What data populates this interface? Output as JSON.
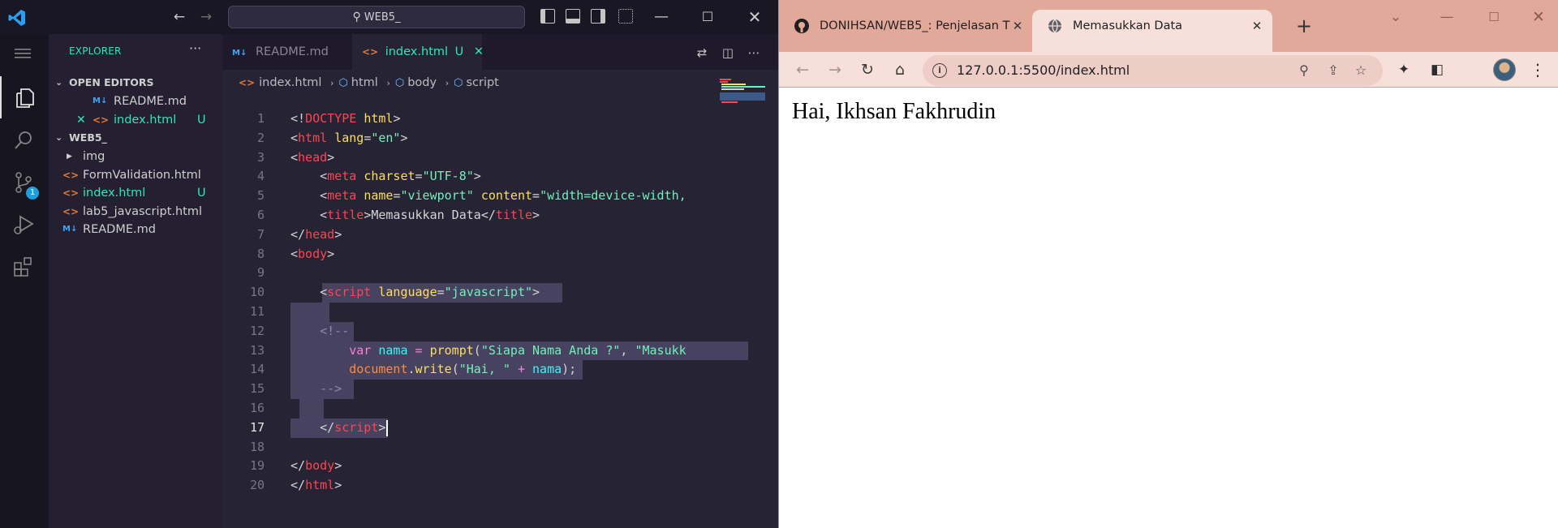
{
  "vscode": {
    "search_text": "WEB5_",
    "sidebar": {
      "title": "EXPLORER",
      "more": "···",
      "open_editors_label": "OPEN EDITORS",
      "open_editors": [
        {
          "name": "README.md",
          "icon": "markdown-icon",
          "flag": ""
        },
        {
          "name": "index.html",
          "icon": "html-icon",
          "flag": "U"
        }
      ],
      "workspace_label": "WEB5_",
      "files": [
        {
          "name": "img",
          "type": "folder",
          "flag": ""
        },
        {
          "name": "FormValidation.html",
          "type": "html",
          "flag": ""
        },
        {
          "name": "index.html",
          "type": "html",
          "flag": "U"
        },
        {
          "name": "lab5_javascript.html",
          "type": "html",
          "flag": ""
        },
        {
          "name": "README.md",
          "type": "markdown",
          "flag": ""
        }
      ]
    },
    "tabs": [
      {
        "label": "README.md",
        "active": false
      },
      {
        "label": "index.html",
        "flag": "U",
        "active": true
      }
    ],
    "breadcrumb": [
      "index.html",
      "html",
      "body",
      "script"
    ],
    "line_numbers": [
      "1",
      "2",
      "3",
      "4",
      "5",
      "6",
      "7",
      "8",
      "9",
      "10",
      "11",
      "12",
      "13",
      "14",
      "15",
      "16",
      "17",
      "18",
      "19",
      "20"
    ],
    "current_line": "17",
    "source_control_badge": "1"
  },
  "chrome": {
    "tabs": [
      {
        "title": "DONIHSAN/WEB5_: Penjelasan T",
        "active": false,
        "icon": "github-icon"
      },
      {
        "title": "Memasukkan Data",
        "active": true,
        "icon": "globe-icon"
      }
    ],
    "url": "127.0.0.1:5500/index.html",
    "page_text": "Hai, Ikhsan Fakhrudin"
  }
}
